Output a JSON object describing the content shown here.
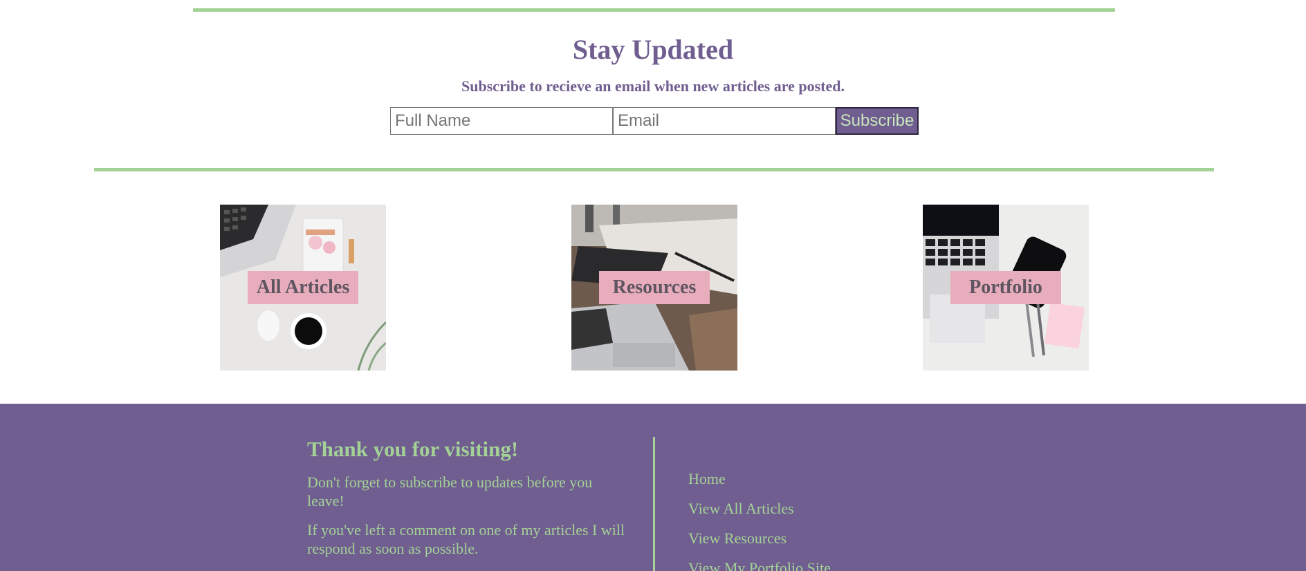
{
  "subscribe": {
    "title": "Stay Updated",
    "subtitle": "Subscribe to recieve an email when new articles are posted.",
    "name_placeholder": "Full Name",
    "email_placeholder": "Email",
    "button_label": "Subscribe"
  },
  "cards": [
    {
      "label": "All Articles",
      "image": "desk-laptop-coffee-image"
    },
    {
      "label": "Resources",
      "image": "laptop-phone-wood-image"
    },
    {
      "label": "Portfolio",
      "image": "laptop-phone-notes-image"
    }
  ],
  "footer": {
    "title": "Thank you for visiting!",
    "paragraph1": "Don't forget to subscribe to updates before you leave!",
    "paragraph2": "If you've left a comment on one of my articles I will respond as soon as possible.",
    "links": [
      "Home",
      "View All Articles",
      "View Resources",
      "View My Portfolio Site"
    ]
  },
  "colors": {
    "accent_green": "#a4d296",
    "brand_purple": "#6f5e8f",
    "label_pink": "#e8adbc"
  }
}
